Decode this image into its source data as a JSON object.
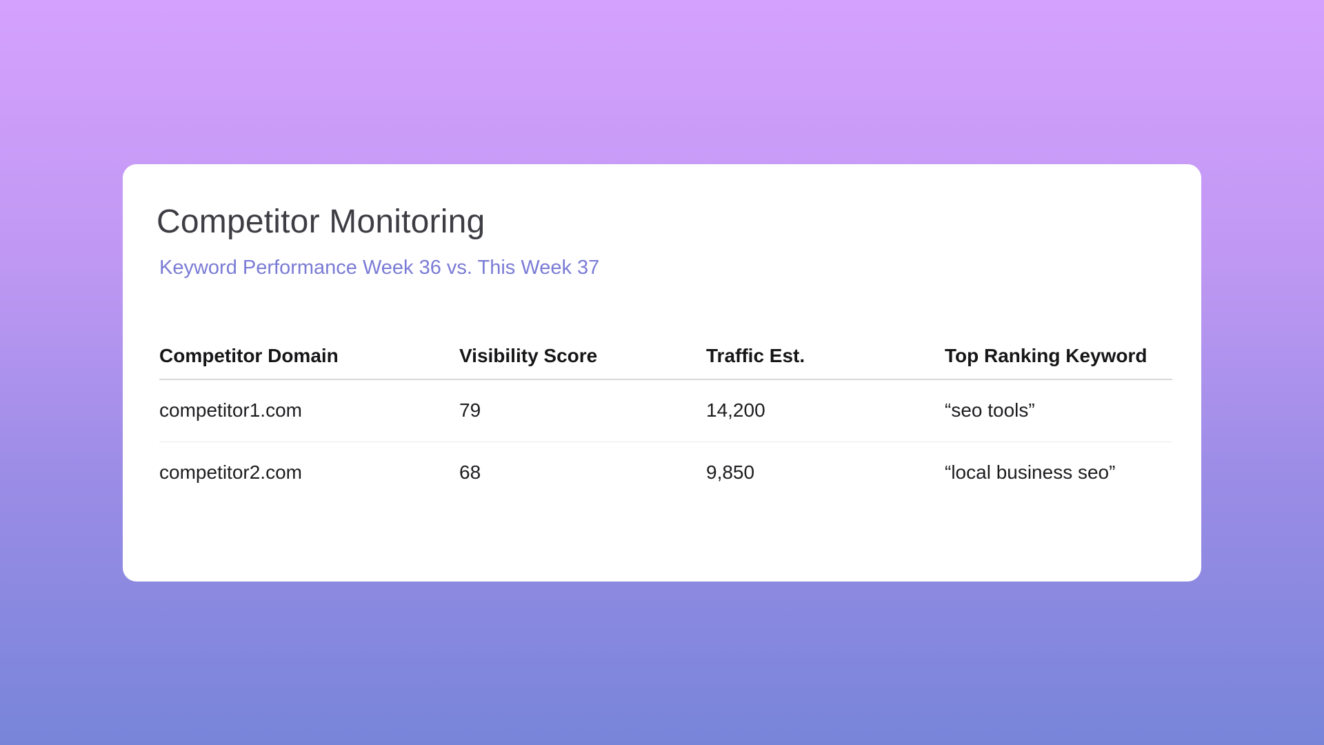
{
  "card": {
    "title": "Competitor Monitoring",
    "subtitle": "Keyword Performance Week 36 vs. This Week 37"
  },
  "table": {
    "columns": [
      "Competitor Domain",
      "Visibility Score",
      "Traffic Est.",
      "Top Ranking Keyword"
    ],
    "rows": [
      [
        "competitor1.com",
        "79",
        "14,200",
        "“seo tools”"
      ],
      [
        "competitor2.com",
        "68",
        "9,850",
        "“local business seo”"
      ]
    ]
  },
  "colors": {
    "background_top": "#d5a1fe",
    "background_bottom": "#7785d9",
    "card": "#ffffff",
    "title": "#3d3d44",
    "subtitle": "#7a7bd5"
  }
}
